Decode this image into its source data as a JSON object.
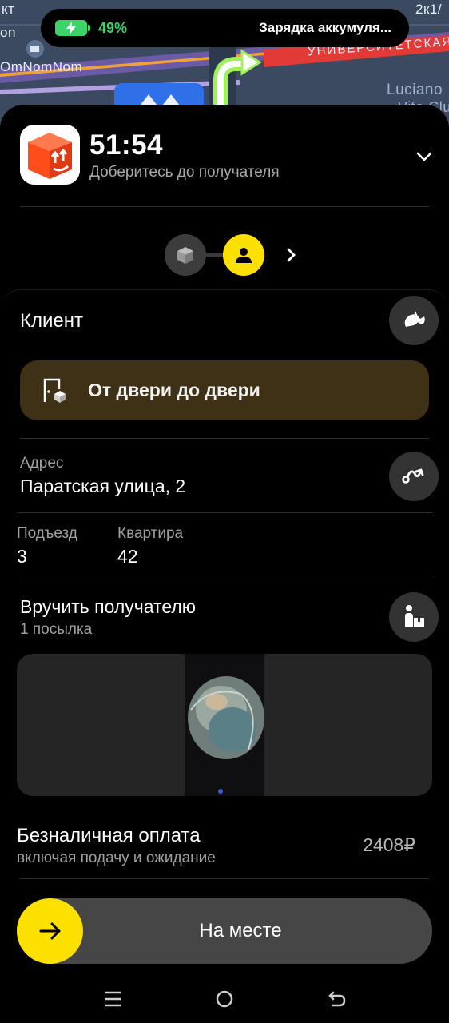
{
  "map": {
    "labels": [
      "кт",
      "on",
      "OmNomNom",
      "УНИВЕРСИТЕТСКАЯ",
      "2к1/",
      "Luciano",
      "Vito Club"
    ]
  },
  "status": {
    "battery_percent": "49%",
    "battery_level": 0.49,
    "charging_text": "Зарядка аккумуля..."
  },
  "header": {
    "timer": "51:54",
    "subtitle": "Доберитесь до получателя",
    "progress_steps": [
      {
        "name": "package",
        "state": "done"
      },
      {
        "name": "recipient",
        "state": "current"
      }
    ]
  },
  "client": {
    "title": "Клиент",
    "door_to_door_label": "От двери до двери"
  },
  "address": {
    "label": "Адрес",
    "value": "Паратская улица, 2",
    "entrance_label": "Подъезд",
    "entrance_value": "3",
    "apartment_label": "Квартира",
    "apartment_value": "42"
  },
  "handover": {
    "title": "Вручить получателю",
    "count": "1 посылка"
  },
  "payment": {
    "title": "Безналичная оплата",
    "subtitle": "включая подачу и ожидание",
    "amount": "2408₽"
  },
  "action": {
    "slider_label": "На месте"
  },
  "colors": {
    "accent": "#fce000",
    "card_bg": "#000000",
    "button_bg": "#333333",
    "d2d_bg": "#3e3116",
    "battery": "#3cd36b",
    "app_icon": "#ff4d1c"
  },
  "icons": {
    "call": "phone-chat-icon",
    "route": "route-icon",
    "handover": "person-parcel-icon",
    "door": "door-box-icon"
  }
}
